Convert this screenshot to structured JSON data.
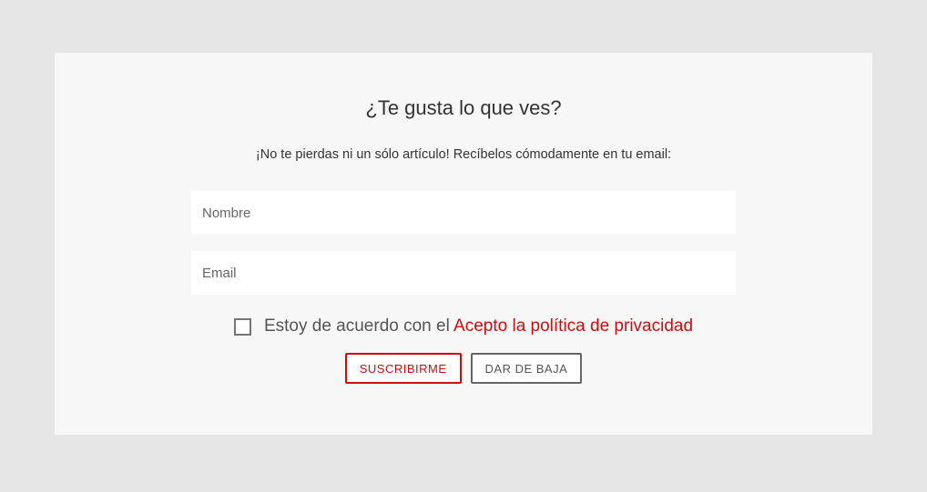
{
  "form": {
    "title": "¿Te gusta lo que ves?",
    "subtitle": "¡No te pierdas ni un sólo artículo! Recíbelos cómodamente en tu email:",
    "name_placeholder": "Nombre",
    "email_placeholder": "Email",
    "consent_prefix": "Estoy de acuerdo con el ",
    "consent_link": "Acepto la política de privacidad",
    "subscribe_label": "SUSCRIBIRME",
    "unsubscribe_label": "DAR DE BAJA"
  }
}
